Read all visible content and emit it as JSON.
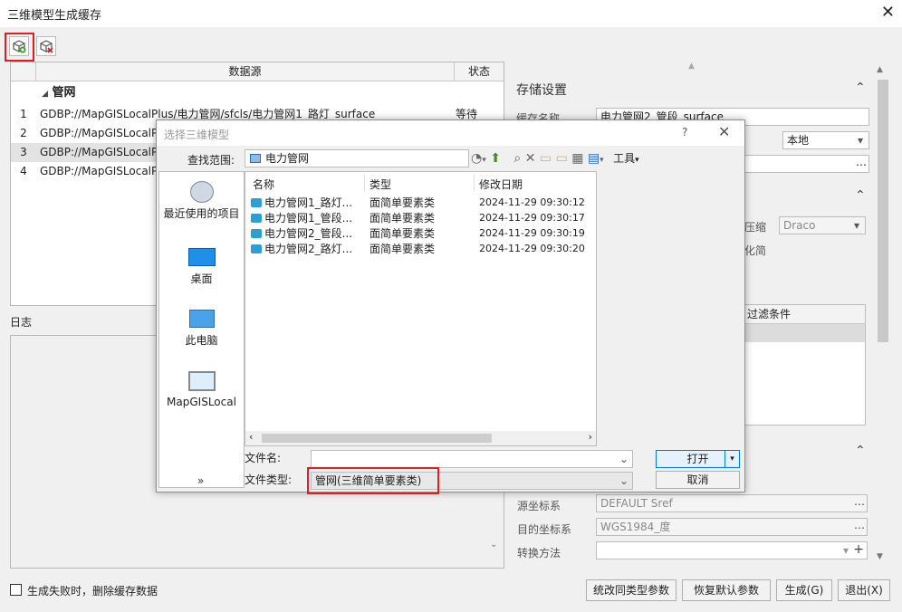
{
  "window": {
    "title": "三维模型生成缓存"
  },
  "grid": {
    "col_source": "数据源",
    "col_status": "状态",
    "group": "管网",
    "rows": [
      {
        "num": "1",
        "source": "GDBP://MapGISLocalPlus/电力管网/sfcls/电力管网1_路灯_surface",
        "status": "等待"
      },
      {
        "num": "2",
        "source": "GDBP://MapGISLocalPlus",
        "status": ""
      },
      {
        "num": "3",
        "source": "GDBP://MapGISLocalPlus",
        "status": ""
      },
      {
        "num": "4",
        "source": "GDBP://MapGISLocalPlus",
        "status": ""
      }
    ]
  },
  "log": {
    "label": "日志"
  },
  "right": {
    "storage_title": "存储设置",
    "cache_name_label": "缓存名称",
    "cache_name_value": "电力管网2_管段_surface",
    "storage_select": "本地",
    "compress_label": "压缩",
    "compress_value": "Draco",
    "simplify_label": "化简",
    "filter_header": "过滤条件",
    "src_crs_label": "源坐标系",
    "src_crs_value": "DEFAULT Sref",
    "dst_crs_label": "目的坐标系",
    "dst_crs_value": "WGS1984_度",
    "transform_label": "转换方法",
    "transform_value": ""
  },
  "footer": {
    "checkbox_label": "生成失败时，删除缓存数据",
    "btn_unify": "统改同类型参数",
    "btn_restore": "恢复默认参数",
    "btn_generate": "生成(G)",
    "btn_exit": "退出(X)"
  },
  "dialog": {
    "title": "选择三维模型",
    "help": "?",
    "lookin_label": "查找范围:",
    "lookin_value": "电力管网",
    "tools_label": "工具",
    "places": [
      {
        "label": "最近使用的项目",
        "icon": "recent-items-icon"
      },
      {
        "label": "桌面",
        "icon": "desktop-icon"
      },
      {
        "label": "此电脑",
        "icon": "this-pc-icon"
      },
      {
        "label": "MapGISLocal",
        "icon": "mapgis-local-icon"
      }
    ],
    "more": "»",
    "columns": {
      "name": "名称",
      "type": "类型",
      "date": "修改日期"
    },
    "files": [
      {
        "name": "电力管网1_路灯...",
        "type": "面简单要素类",
        "date": "2024-11-29 09:30:12"
      },
      {
        "name": "电力管网1_管段...",
        "type": "面简单要素类",
        "date": "2024-11-29 09:30:17"
      },
      {
        "name": "电力管网2_管段...",
        "type": "面简单要素类",
        "date": "2024-11-29 09:30:19"
      },
      {
        "name": "电力管网2_路灯...",
        "type": "面简单要素类",
        "date": "2024-11-29 09:30:20"
      }
    ],
    "filename_label": "文件名:",
    "filename_value": "",
    "filetype_label": "文件类型:",
    "filetype_value": "管网(三维简单要素类)",
    "btn_open": "打开",
    "btn_cancel": "取消"
  }
}
